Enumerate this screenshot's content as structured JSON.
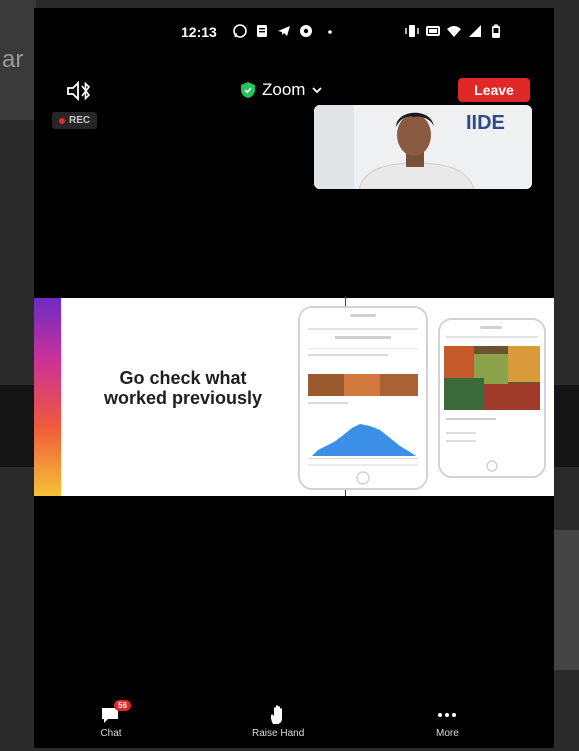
{
  "background": {
    "text_fragment": "ar"
  },
  "statusbar": {
    "time": "12:13"
  },
  "topbar": {
    "meeting_title": "Zoom",
    "leave_label": "Leave"
  },
  "recording": {
    "label": "REC"
  },
  "self_video": {
    "logo_text": "IIDE"
  },
  "share": {
    "slide_text": "Go check what worked previously"
  },
  "bottombar": {
    "chat_label": "Chat",
    "chat_count": "56",
    "raise_hand_label": "Raise Hand",
    "more_label": "More"
  },
  "colors": {
    "leave": "#e02828",
    "shield": "#22c55e",
    "gradient_top": "#6b2cc4",
    "gradient_bottom": "#f5c238"
  }
}
